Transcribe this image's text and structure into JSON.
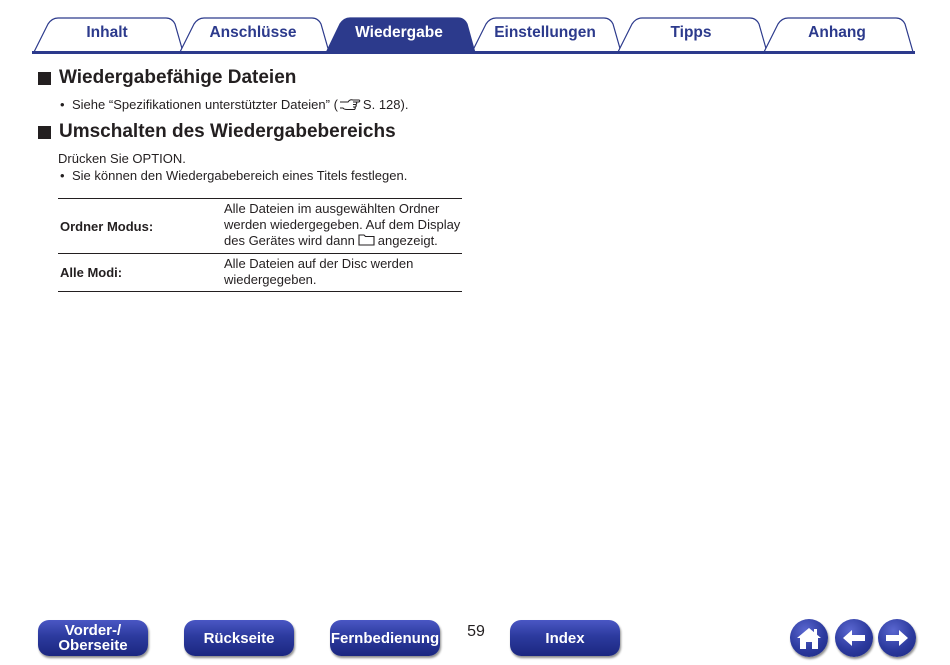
{
  "tabs": [
    {
      "label": "Inhalt",
      "active": false
    },
    {
      "label": "Anschlüsse",
      "active": false
    },
    {
      "label": "Wiedergabe",
      "active": true
    },
    {
      "label": "Einstellungen",
      "active": false
    },
    {
      "label": "Tipps",
      "active": false
    },
    {
      "label": "Anhang",
      "active": false
    }
  ],
  "colors": {
    "tab_active": "#2c3a8c",
    "tab_text": "#2c3a8c",
    "nav_button": "#2c3a9e"
  },
  "section1": {
    "title": "Wiedergabefähige Dateien",
    "bullet_before": "Siehe “Spezifikationen unterstützter Dateien” (",
    "bullet_ref": "S. 128).",
    "ref_icon": "pointing-hand-icon"
  },
  "section2": {
    "title": "Umschalten des Wiedergabebereichs",
    "intro": "Drücken Sie OPTION.",
    "bullet": "Sie können den Wiedergabebereich eines Titels festlegen.",
    "table": [
      {
        "key": "Ordner Modus:",
        "value_line1": "Alle Dateien im ausgewählten Ordner",
        "value_line2": "werden wiedergegeben. Auf dem Display",
        "value_line3_before": "des Gerätes wird dann",
        "value_icon": "folder-icon",
        "value_line3_after": "angezeigt."
      },
      {
        "key": "Alle Modi:",
        "value_line1": "Alle Dateien auf der Disc werden",
        "value_line2": "wiedergegeben."
      }
    ]
  },
  "footer": {
    "front_line1": "Vorder-/",
    "front_line2": "Oberseite",
    "back": "Rückseite",
    "remote": "Fernbedienung",
    "page_number": "59",
    "index": "Index",
    "home_icon": "home-icon",
    "back_icon": "arrow-left-icon",
    "forward_icon": "arrow-right-icon"
  }
}
